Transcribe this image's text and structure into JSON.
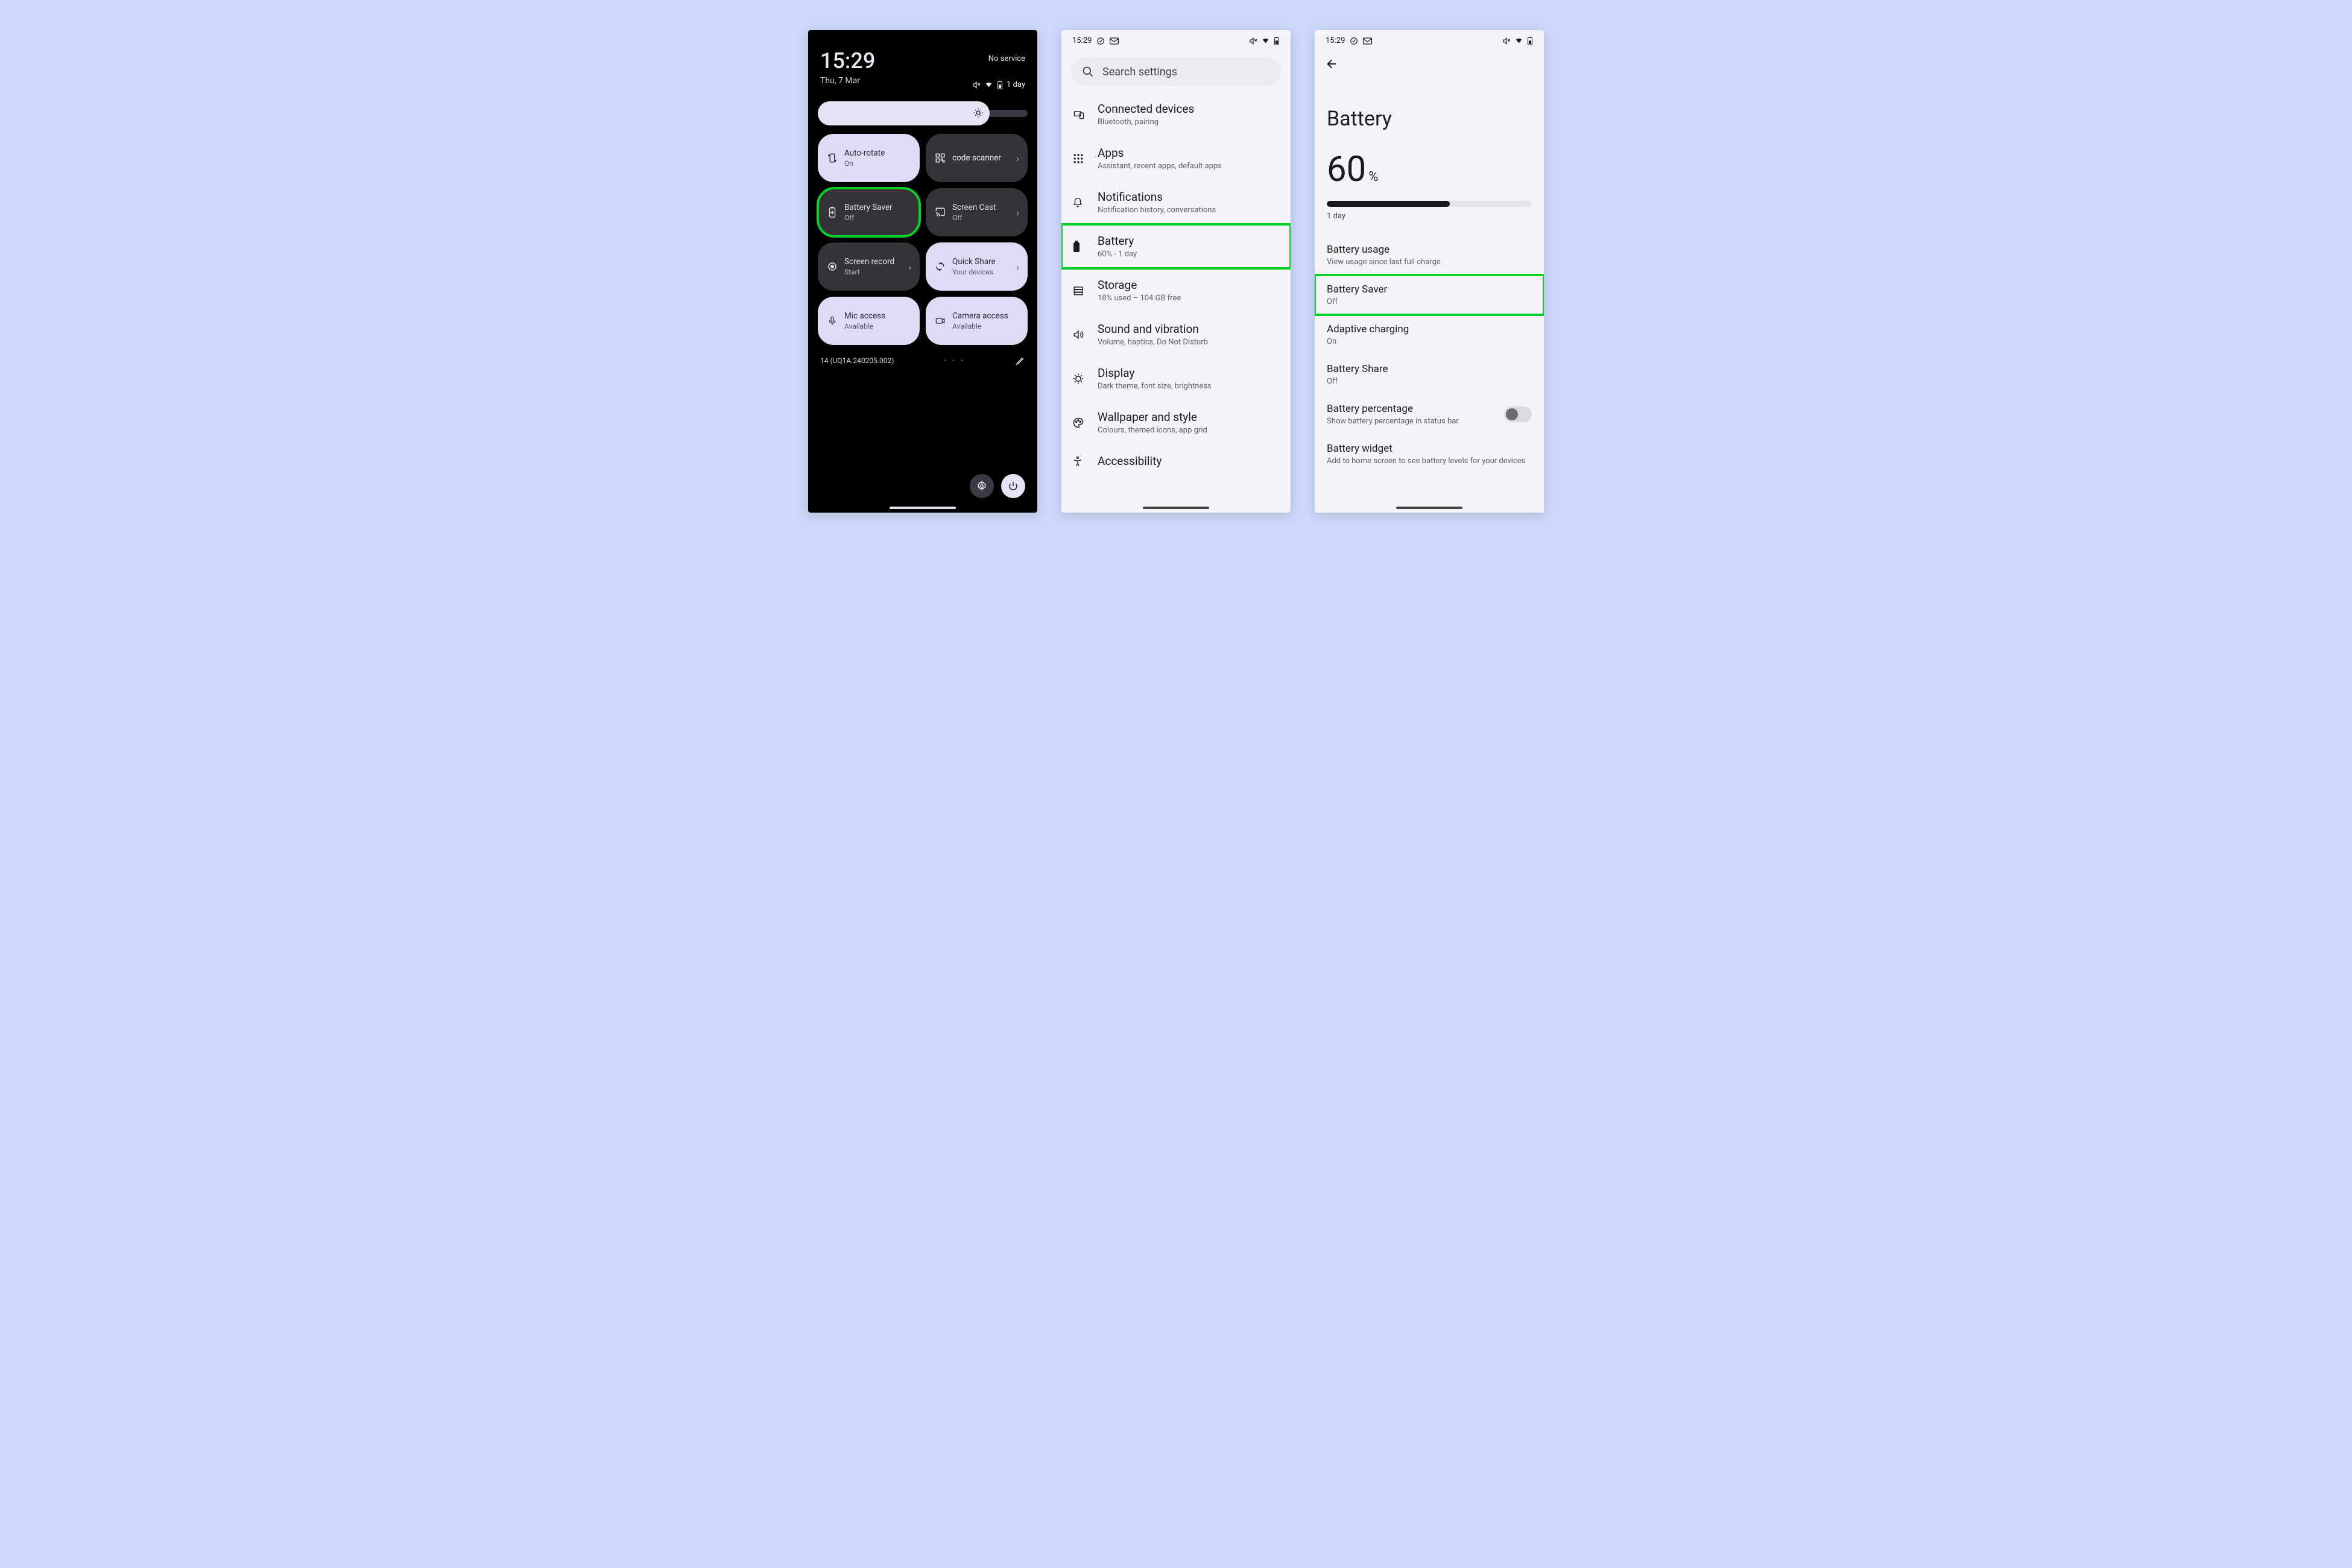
{
  "colors": {
    "highlight": "#00d227"
  },
  "screen1": {
    "time": "15:29",
    "date": "Thu, 7 Mar",
    "network": "No service",
    "battery_estimate": "1 day",
    "build": "14 (UQ1A.240205.002)",
    "tiles": [
      {
        "icon": "rotate",
        "label": "Auto-rotate",
        "sub": "On",
        "on": true,
        "chev": false
      },
      {
        "icon": "qr",
        "label": "code scanner",
        "sub": "",
        "on": false,
        "chev": true,
        "truncated": true
      },
      {
        "icon": "battery",
        "label": "Battery Saver",
        "sub": "Off",
        "on": false,
        "chev": false,
        "highlight": true
      },
      {
        "icon": "cast",
        "label": "Screen Cast",
        "sub": "Off",
        "on": false,
        "chev": true
      },
      {
        "icon": "record",
        "label": "Screen record",
        "sub": "Start",
        "on": false,
        "chev": true
      },
      {
        "icon": "share",
        "label": "Quick Share",
        "sub": "Your devices",
        "on": true,
        "chev": true
      },
      {
        "icon": "mic",
        "label": "Mic access",
        "sub": "Available",
        "on": true,
        "chev": false
      },
      {
        "icon": "camera",
        "label": "Camera access",
        "sub": "Available",
        "on": true,
        "chev": false
      }
    ]
  },
  "screen2": {
    "time": "15:29",
    "search_placeholder": "Search settings",
    "rows": [
      {
        "icon": "devices",
        "title": "Connected devices",
        "sub": "Bluetooth, pairing"
      },
      {
        "icon": "apps",
        "title": "Apps",
        "sub": "Assistant, recent apps, default apps"
      },
      {
        "icon": "bell",
        "title": "Notifications",
        "sub": "Notification history, conversations"
      },
      {
        "icon": "battery",
        "title": "Battery",
        "sub": "60% - 1 day",
        "highlight": true
      },
      {
        "icon": "storage",
        "title": "Storage",
        "sub": "18% used – 104 GB free"
      },
      {
        "icon": "sound",
        "title": "Sound and vibration",
        "sub": "Volume, haptics, Do Not Disturb"
      },
      {
        "icon": "display",
        "title": "Display",
        "sub": "Dark theme, font size, brightness"
      },
      {
        "icon": "palette",
        "title": "Wallpaper and style",
        "sub": "Colours, themed icons, app grid"
      },
      {
        "icon": "a11y",
        "title": "Accessibility",
        "sub": ""
      }
    ]
  },
  "screen3": {
    "time": "15:29",
    "title": "Battery",
    "percent": "60",
    "percent_sym": "%",
    "estimate": "1 day",
    "options": [
      {
        "title": "Battery usage",
        "sub": "View usage since last full charge"
      },
      {
        "title": "Battery Saver",
        "sub": "Off",
        "highlight": true
      },
      {
        "title": "Adaptive charging",
        "sub": "On"
      },
      {
        "title": "Battery Share",
        "sub": "Off"
      },
      {
        "title": "Battery percentage",
        "sub": "Show battery percentage in status bar",
        "switch": true
      },
      {
        "title": "Battery widget",
        "sub": "Add to home screen to see battery levels for your devices"
      }
    ]
  }
}
